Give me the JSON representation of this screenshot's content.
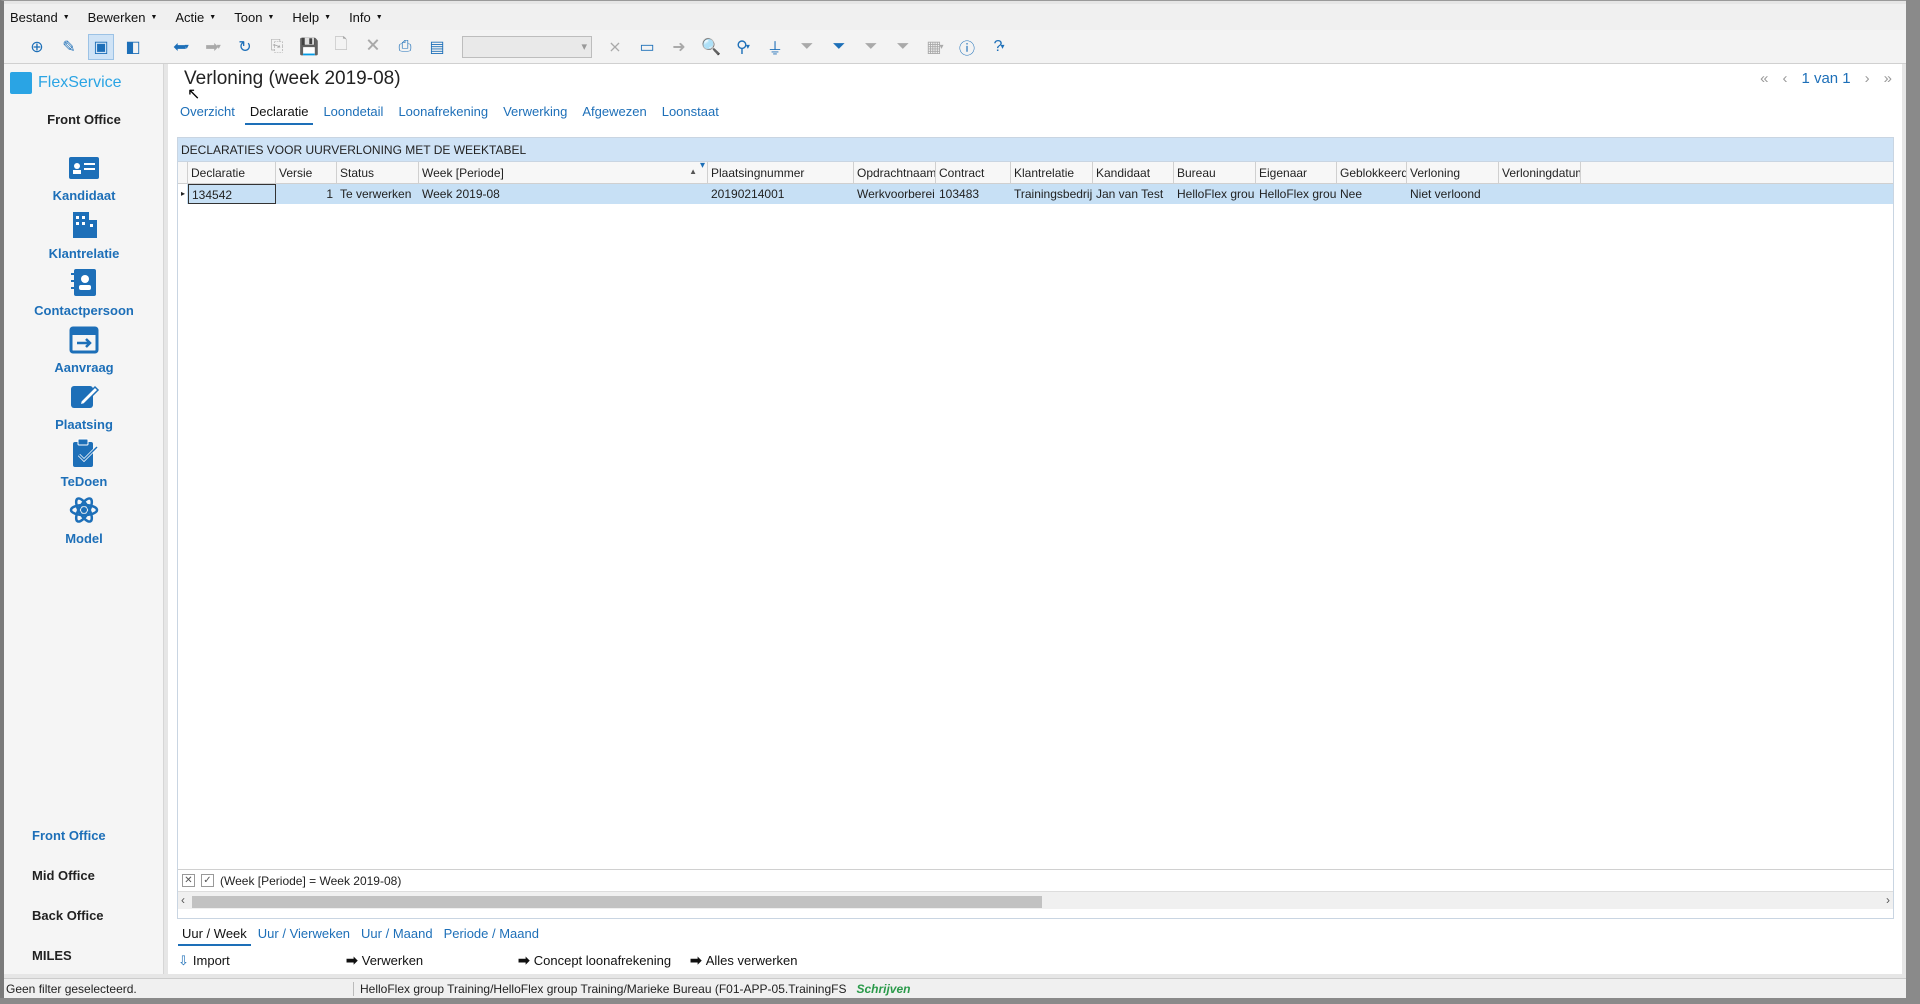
{
  "menu": [
    {
      "label": "Bestand"
    },
    {
      "label": "Bewerken"
    },
    {
      "label": "Actie"
    },
    {
      "label": "Toon"
    },
    {
      "label": "Help"
    },
    {
      "label": "Info"
    }
  ],
  "sidebar": {
    "logo": "FlexService",
    "header": "Front Office",
    "items": [
      {
        "label": "Kandidaat",
        "icon": "id-card-icon"
      },
      {
        "label": "Klantrelatie",
        "icon": "building-icon"
      },
      {
        "label": "Contactpersoon",
        "icon": "contact-book-icon"
      },
      {
        "label": "Aanvraag",
        "icon": "calendar-arrow-icon"
      },
      {
        "label": "Plaatsing",
        "icon": "edit-icon"
      },
      {
        "label": "TeDoen",
        "icon": "clipboard-check-icon"
      },
      {
        "label": "Model",
        "icon": "atom-icon"
      }
    ],
    "bottom": [
      "Front Office",
      "Mid Office",
      "Back Office",
      "MILES"
    ]
  },
  "main": {
    "title": "Verloning (week 2019-08)",
    "pager": "1 van 1",
    "tabs": [
      "Overzicht",
      "Declaratie",
      "Loondetail",
      "Loonafrekening",
      "Verwerking",
      "Afgewezen",
      "Loonstaat"
    ],
    "active_tab": "Declaratie",
    "grid": {
      "caption": "DECLARATIES VOOR UURVERLONING MET DE WEEKTABEL",
      "columns": [
        "Declaratie",
        "Versie",
        "Status",
        "Week [Periode]",
        "Plaatsingnummer",
        "Opdrachtnaam",
        "Contract",
        "Klantrelatie",
        "Kandidaat",
        "Bureau",
        "Eigenaar",
        "Geblokkeerd",
        "Verloning",
        "Verloningdatum"
      ],
      "rows": [
        [
          "134542",
          "1",
          "Te verwerken",
          "Week 2019-08",
          "20190214001",
          "Werkvoorbereide",
          "103483",
          "Trainingsbedrijf",
          "Jan van Test",
          "HelloFlex group T",
          "HelloFlex group T",
          "Nee",
          "Niet verloond",
          ""
        ]
      ],
      "filter": "(Week [Periode] = Week 2019-08)"
    },
    "subtabs": [
      "Uur / Week",
      "Uur / Vierweken",
      "Uur / Maand",
      "Periode / Maand"
    ],
    "actions": [
      "Import",
      "Verwerken",
      "Concept loonafrekening",
      "Alles verwerken"
    ]
  },
  "status": {
    "left": "Geen filter geselecteerd.",
    "path": "HelloFlex group Training/HelloFlex group Training/Marieke Bureau (F01-APP-05.TrainingFS",
    "mode": "Schrijven"
  },
  "colors": {
    "accent": "#1d6fb8",
    "selection": "#c7e0f5",
    "logo": "#2aa4e4",
    "status_mode": "#2a9a4a"
  }
}
